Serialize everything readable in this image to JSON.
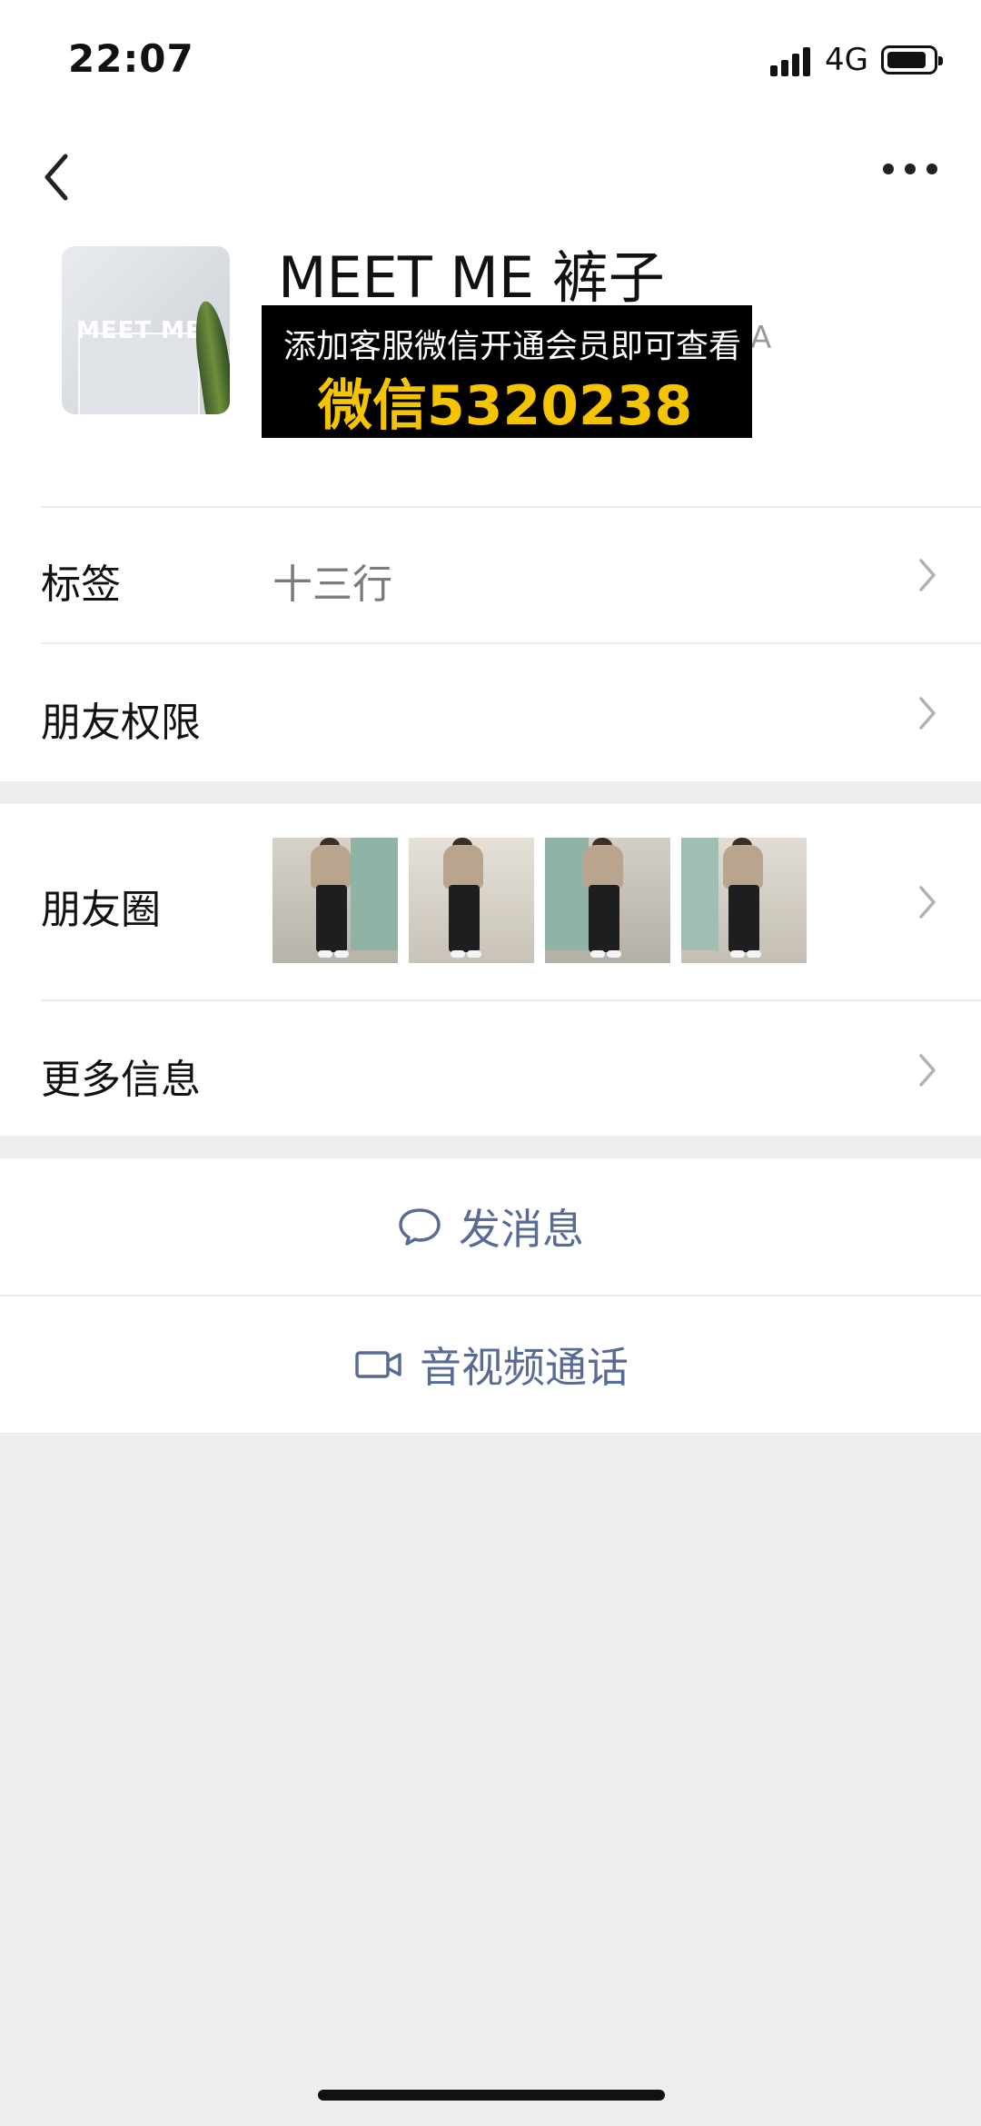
{
  "status": {
    "time": "22:07",
    "network": "4G"
  },
  "profile": {
    "name": "MEET ME 裤子",
    "avatar_text": "MEET ME",
    "promo_line1": "添加客服微信开通会员即可查看",
    "promo_line2": "微信5320238",
    "hidden_tail": "A"
  },
  "rows": {
    "tags_label": "标签",
    "tags_value": "十三行",
    "permissions_label": "朋友权限",
    "moments_label": "朋友圈",
    "more_info_label": "更多信息"
  },
  "actions": {
    "message_label": "发消息",
    "video_call_label": "音视频通话"
  },
  "icons": [
    "back-chevron-icon",
    "more-dots-icon",
    "chevron-right-icon",
    "chat-bubble-icon",
    "video-camera-icon"
  ],
  "colors": {
    "link": "#576b95",
    "promo_yellow": "#f4c400",
    "background": "#ededed"
  }
}
